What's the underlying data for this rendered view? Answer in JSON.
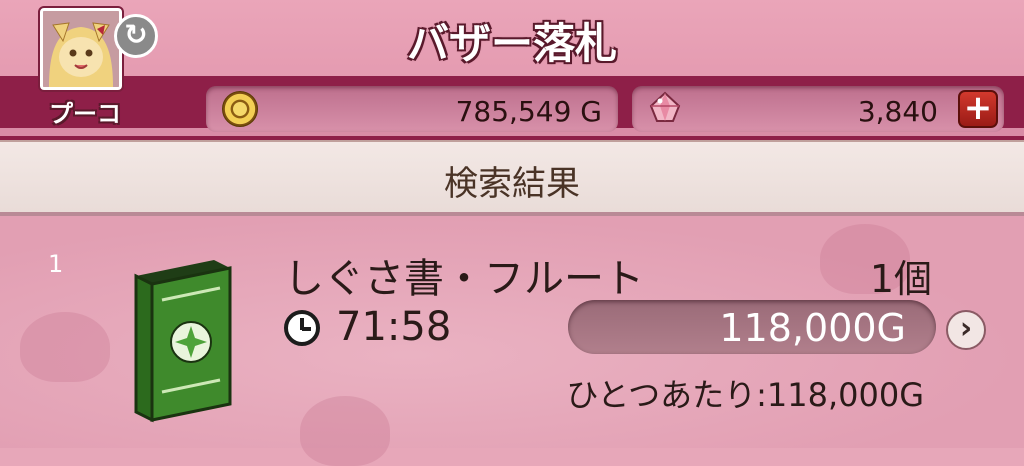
{
  "header": {
    "title": "バザー落札",
    "character_name": "プーコ"
  },
  "currencies": {
    "gold": {
      "value": "785,549 G",
      "icon": "gold-coin-icon"
    },
    "gems": {
      "value": "3,840",
      "icon": "gem-icon",
      "add_label": "+"
    }
  },
  "results": {
    "title": "検索結果",
    "items": [
      {
        "index": "1",
        "name": "しぐさ書・フルート",
        "quantity": "1個",
        "time_left": "71:58",
        "price": "118,000G",
        "unit_price": "ひとつあたり:118,000G",
        "icon": "green-book-icon"
      }
    ]
  },
  "colors": {
    "header_bg": "#e093aa",
    "bar_bg": "#8e1f48",
    "results_bar_bg": "#f3e8e5",
    "list_bg": "#e29fb3",
    "price_pill_bg": "#9a6b78",
    "plus_button": "#c0302a"
  }
}
